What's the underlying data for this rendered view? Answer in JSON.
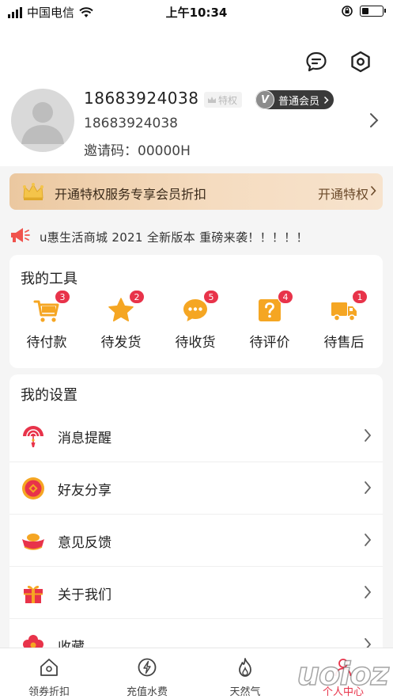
{
  "status_bar": {
    "carrier": "中国电信",
    "time": "上午10:34",
    "battery_level": 0.35
  },
  "header": {
    "message_icon": "chat-bubble-icon",
    "settings_icon": "hexagon-settings-icon"
  },
  "user": {
    "phone": "18683924038",
    "sub_phone": "18683924038",
    "invite_label": "邀请码：",
    "invite_code": "00000H",
    "privilege_badge": "特权",
    "member_icon_letter": "V",
    "member_level": "普通会员"
  },
  "vip_banner": {
    "text": "开通特权服务专享会员折扣",
    "action": "开通特权"
  },
  "notice": {
    "text": "u惠生活商城  2021 全新版本 重磅来袭！！！！！"
  },
  "tools": {
    "title": "我的工具",
    "items": [
      {
        "label": "待付款",
        "badge": "3",
        "icon": "shopping-cart-icon"
      },
      {
        "label": "待发货",
        "badge": "2",
        "icon": "star-icon"
      },
      {
        "label": "待收货",
        "badge": "5",
        "icon": "chat-dots-icon"
      },
      {
        "label": "待评价",
        "badge": "4",
        "icon": "question-box-icon"
      },
      {
        "label": "待售后",
        "badge": "1",
        "icon": "delivery-truck-icon"
      }
    ]
  },
  "settings": {
    "title": "我的设置",
    "items": [
      {
        "label": "消息提醒",
        "icon": "fan-icon"
      },
      {
        "label": "好友分享",
        "icon": "coin-icon"
      },
      {
        "label": "意见反馈",
        "icon": "gold-ingot-icon"
      },
      {
        "label": "关于我们",
        "icon": "gift-box-icon"
      },
      {
        "label": "收藏",
        "icon": "flower-icon"
      }
    ]
  },
  "tabbar": {
    "items": [
      {
        "label": "领券折扣",
        "icon": "home-icon",
        "active": false
      },
      {
        "label": "充值水费",
        "icon": "lightning-icon",
        "active": false
      },
      {
        "label": "天然气",
        "icon": "flame-icon",
        "active": false
      },
      {
        "label": "个人中心",
        "icon": "person-icon",
        "active": true
      }
    ]
  },
  "watermark": "uoioz",
  "colors": {
    "accent_red": "#e8334a",
    "tool_orange": "#f5a623",
    "vip_gold": "#ebc8a0"
  }
}
